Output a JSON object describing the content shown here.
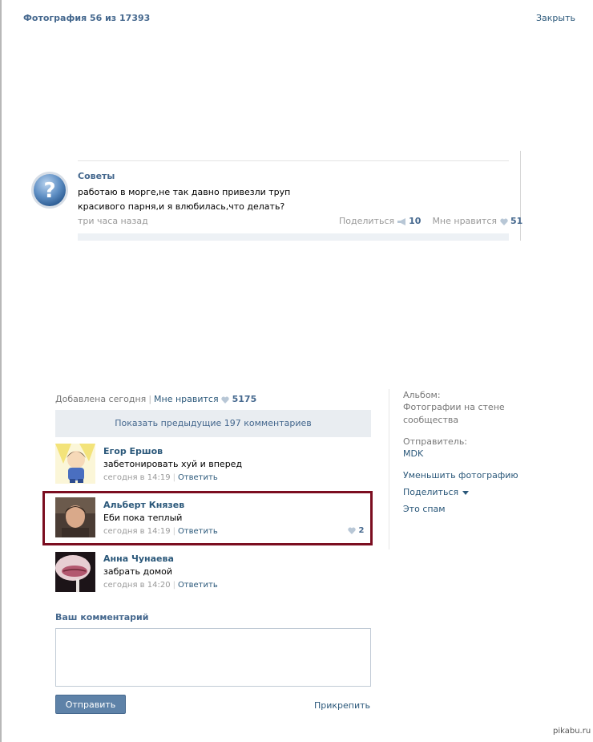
{
  "header": {
    "title": "Фотография 56 из 17393",
    "close": "Закрыть"
  },
  "post": {
    "author": "Советы",
    "text_line1": "работаю в морге,не так давно привезли труп",
    "text_line2": "красивого парня,и я влюбилась,что делать?",
    "time": "три часа назад",
    "share_label": "Поделиться",
    "share_count": "10",
    "like_label": "Мне нравится",
    "like_count": "51"
  },
  "info": {
    "added": "Добавлена сегодня",
    "like_label": "Мне нравится",
    "like_count": "5175"
  },
  "prev_comments": "Показать предыдущие 197 комментариев",
  "comments": [
    {
      "name": "Егор Ершов",
      "text": "забетонировать хуй и вперед",
      "time": "сегодня в 14:19",
      "reply": "Ответить"
    },
    {
      "name": "Альберт Князев",
      "text": "Еби пока теплый",
      "time": "сегодня в 14:19",
      "reply": "Ответить",
      "likes": "2"
    },
    {
      "name": "Анна Чунаева",
      "text": "забрать домой",
      "time": "сегодня в 14:20",
      "reply": "Ответить"
    }
  ],
  "sidebar": {
    "album_label": "Альбом:",
    "album_value": "Фотографии на стене сообщества",
    "sender_label": "Отправитель:",
    "sender_value": "MDK",
    "shrink": "Уменьшить фотографию",
    "share": "Поделиться",
    "spam": "Это спам"
  },
  "form": {
    "title": "Ваш комментарий",
    "send": "Отправить",
    "attach": "Прикрепить"
  },
  "watermark": "pikabu.ru",
  "colors": {
    "link": "#2b587a",
    "accent": "#45688e",
    "highlight_border": "#7b0d20",
    "button": "#5e82a8"
  }
}
